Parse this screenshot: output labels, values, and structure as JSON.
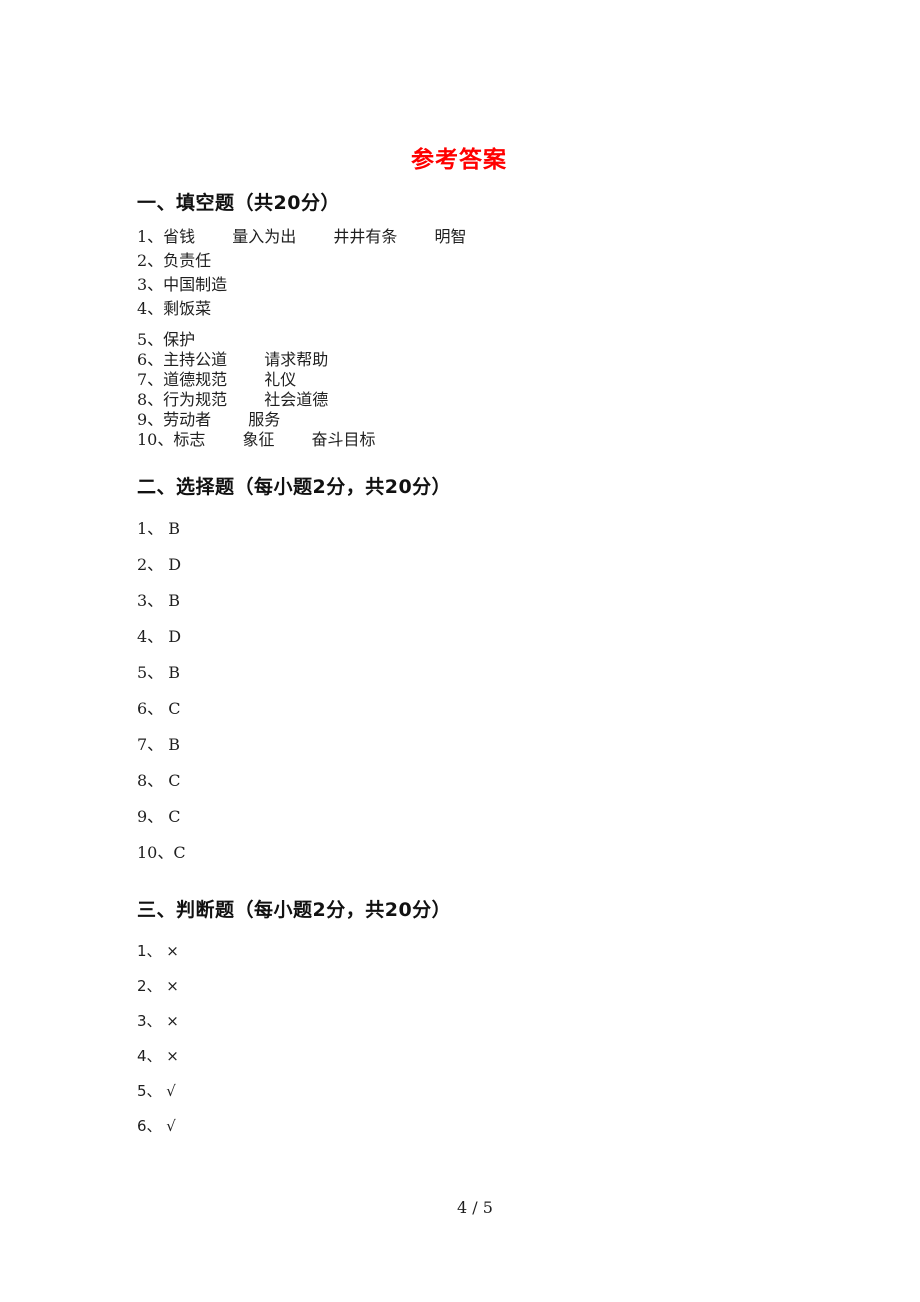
{
  "title": "参考答案",
  "title_color": "#ff0000",
  "sections": [
    {
      "heading": "一、填空题（共20分）",
      "items": [
        "1、省钱　　 量入为出　　 井井有条　　 明智",
        "2、负责任",
        "3、中国制造",
        "4、剩饭菜",
        "5、保护",
        "6、主持公道　　 请求帮助",
        "7、道德规范　　 礼仪",
        "8、行为规范　　 社会道德",
        "9、劳动者　　 服务",
        "10、标志　　 象征　　 奋斗目标"
      ]
    },
    {
      "heading": "二、选择题（每小题2分，共20分）",
      "items": [
        "1、 B",
        "2、 D",
        "3、 B",
        "4、 D",
        "5、 B",
        "6、 C",
        "7、 B",
        "8、 C",
        "9、 C",
        "10、C"
      ]
    },
    {
      "heading": "三、判断题（每小题2分，共20分）",
      "items": [
        "1、 ×",
        "2、 ×",
        "3、 ×",
        "4、 ×",
        "5、 √",
        "6、 √"
      ]
    }
  ],
  "footer": {
    "page": "4 / 5"
  }
}
